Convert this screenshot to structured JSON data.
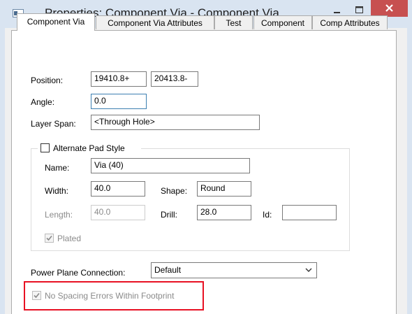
{
  "window": {
    "title": "Properties: Component Via - Component Via"
  },
  "tabs": [
    {
      "label": "Component Via"
    },
    {
      "label": "Component Via Attributes"
    },
    {
      "label": "Test"
    },
    {
      "label": "Component"
    },
    {
      "label": "Comp Attributes"
    }
  ],
  "form": {
    "position_label": "Position:",
    "position_x": "19410.8+",
    "position_y": "20413.8-",
    "angle_label": "Angle:",
    "angle_value": "0.0",
    "layer_span_label": "Layer Span:",
    "layer_span_value": "<Through Hole>"
  },
  "pad_style": {
    "alternate_label": "Alternate Pad Style",
    "alternate_checked": false,
    "name_label": "Name:",
    "name_value": "Via (40)",
    "width_label": "Width:",
    "width_value": "40.0",
    "shape_label": "Shape:",
    "shape_value": "Round",
    "length_label": "Length:",
    "length_value": "40.0",
    "drill_label": "Drill:",
    "drill_value": "28.0",
    "id_label": "Id:",
    "id_value": "",
    "plated_label": "Plated",
    "plated_checked": true
  },
  "power_plane": {
    "label": "Power Plane Connection:",
    "value": "Default"
  },
  "spacing": {
    "label": "No Spacing Errors Within Footprint",
    "checked": true
  },
  "colors": {
    "titlebar_bg": "#d9e4f1",
    "close_button": "#c75050",
    "highlight_border": "#e81123"
  }
}
